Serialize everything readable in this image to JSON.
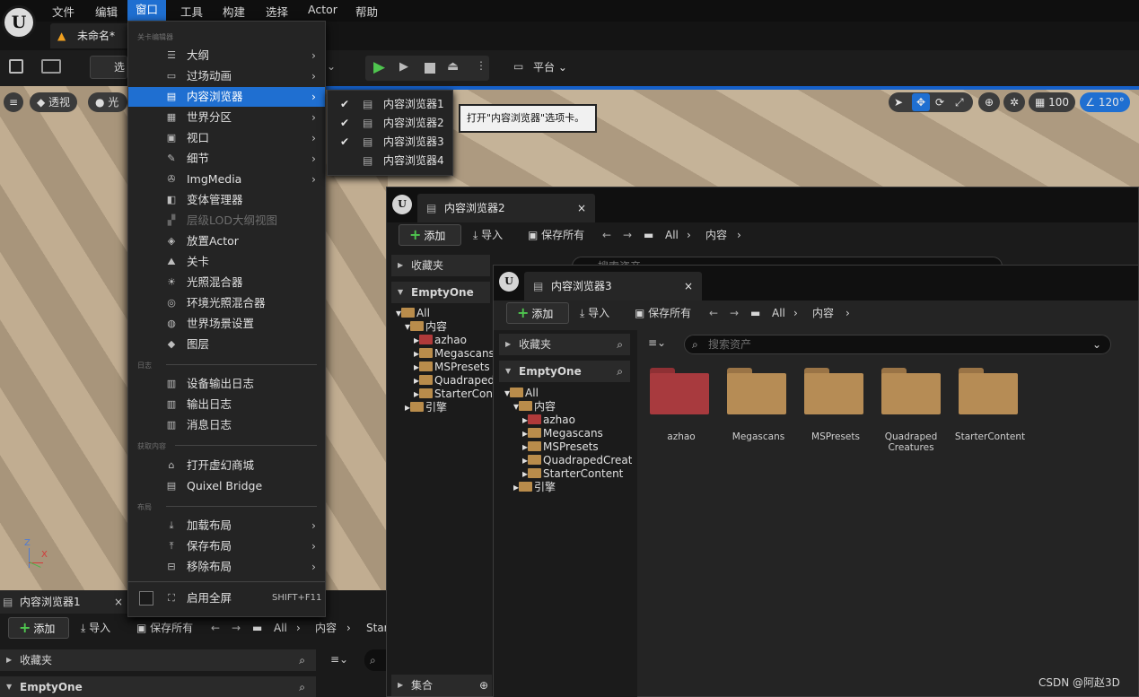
{
  "menubar": {
    "items": [
      "文件",
      "编辑",
      "窗口",
      "工具",
      "构建",
      "选择",
      "Actor",
      "帮助"
    ],
    "active": "窗口"
  },
  "logo": {
    "letter": "U"
  },
  "doc_tab": {
    "label": "未命名*"
  },
  "toolbar": {
    "select_label": "选",
    "platform_label": "平台"
  },
  "viewport": {
    "perspective": "透视",
    "lighting": "光",
    "grid_value": "100",
    "angle_value": "120°"
  },
  "window_menu": {
    "sections": {
      "level_editor": "关卡编辑器",
      "log": "日志",
      "get_content": "获取内容",
      "layout": "布局"
    },
    "items": [
      {
        "label": "大纲",
        "arrow": true
      },
      {
        "label": "过场动画",
        "arrow": true
      },
      {
        "label": "内容浏览器",
        "arrow": true
      },
      {
        "label": "世界分区",
        "arrow": true
      },
      {
        "label": "视口",
        "arrow": true
      },
      {
        "label": "细节",
        "arrow": true
      },
      {
        "label": "ImgMedia",
        "arrow": true
      },
      {
        "label": "变体管理器"
      },
      {
        "label": "层级LOD大纲视图",
        "disabled": true
      },
      {
        "label": "放置Actor"
      },
      {
        "label": "关卡"
      },
      {
        "label": "光照混合器"
      },
      {
        "label": "环境光照混合器"
      },
      {
        "label": "世界场景设置"
      },
      {
        "label": "图层"
      },
      {
        "label": "设备输出日志"
      },
      {
        "label": "输出日志"
      },
      {
        "label": "消息日志"
      },
      {
        "label": "打开虚幻商城"
      },
      {
        "label": "Quixel Bridge"
      },
      {
        "label": "加载布局",
        "arrow": true
      },
      {
        "label": "保存布局",
        "arrow": true
      },
      {
        "label": "移除布局",
        "arrow": true
      },
      {
        "label": "启用全屏",
        "shortcut": "SHIFT+F11"
      }
    ]
  },
  "content_browser_submenu": {
    "items": [
      {
        "label": "内容浏览器1",
        "checked": true
      },
      {
        "label": "内容浏览器2",
        "checked": true
      },
      {
        "label": "内容浏览器3",
        "checked": true
      },
      {
        "label": "内容浏览器4",
        "checked": false
      }
    ]
  },
  "tooltip": {
    "text": "打开\"内容浏览器\"选项卡。"
  },
  "cb_common": {
    "add": "添加",
    "import": "导入",
    "save_all": "保存所有",
    "path_all": "All",
    "path_content": "内容",
    "favorites": "收藏夹",
    "project": "EmptyOne",
    "search_placeholder": "搜索资产",
    "collections": "集合"
  },
  "browser1": {
    "tab": "内容浏览器1",
    "path_start": "Star"
  },
  "browser2": {
    "tab": "内容浏览器2",
    "search_placeholder": "搜索资产"
  },
  "browser3": {
    "tab": "内容浏览器3"
  },
  "tree": {
    "root": "All",
    "content": "内容",
    "folders": [
      "azhao",
      "Megascans",
      "MSPresets",
      "QuadrapedCreatures",
      "StarterContent"
    ],
    "engine": "引擎"
  },
  "assets": [
    {
      "label": "azhao",
      "color": "#a83a3e"
    },
    {
      "label": "Megascans",
      "color": "#b68c55"
    },
    {
      "label": "MSPresets",
      "color": "#b68c55"
    },
    {
      "label": "Quadraped Creatures",
      "color": "#b68c55"
    },
    {
      "label": "StarterContent",
      "color": "#b68c55"
    }
  ],
  "watermark": "CSDN @阿赵3D"
}
